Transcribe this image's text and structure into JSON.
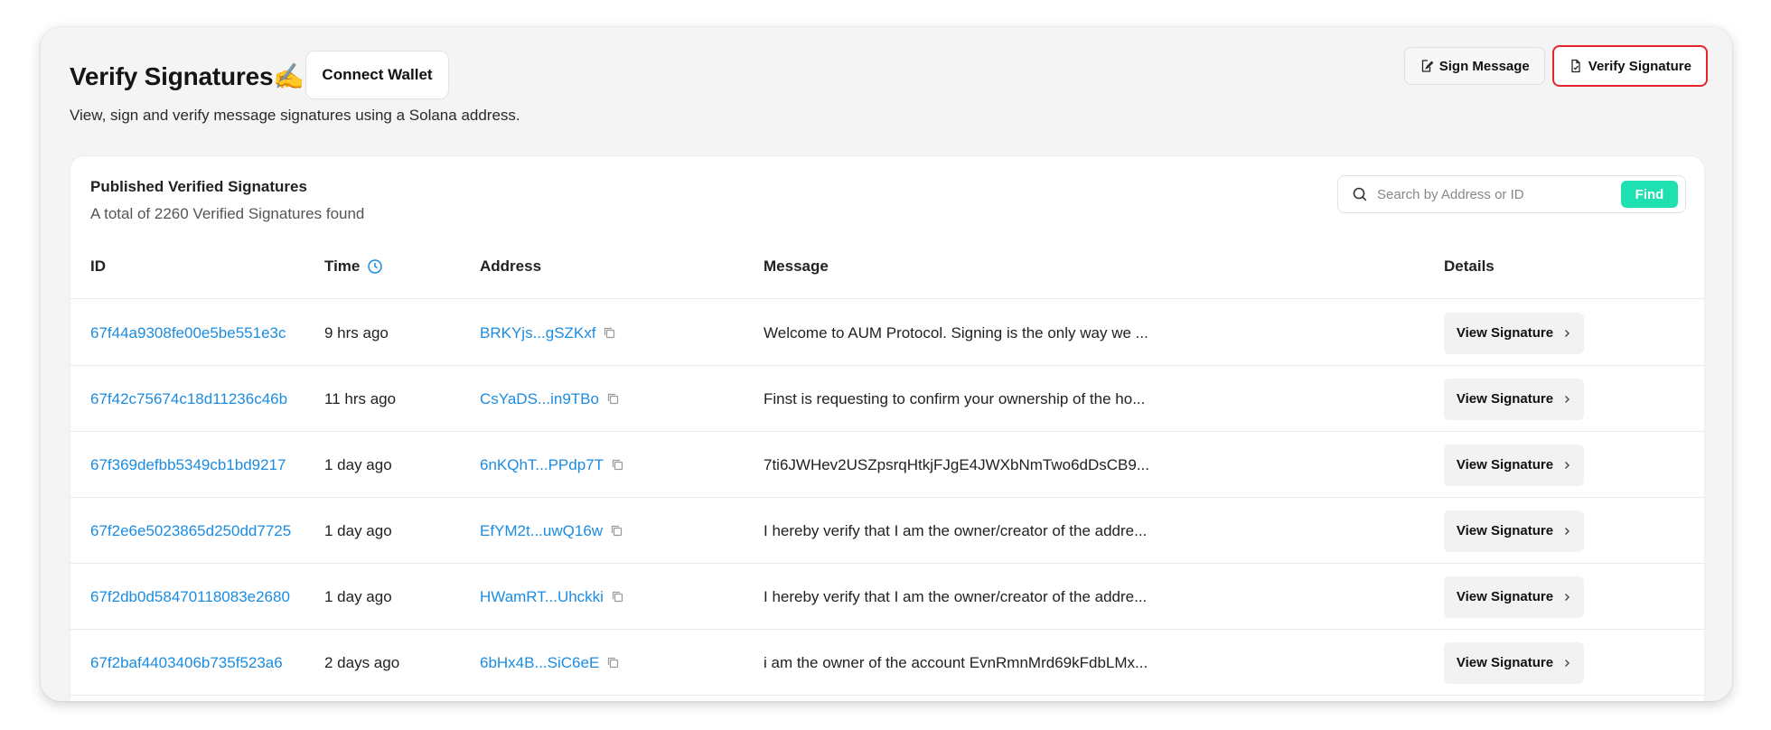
{
  "header": {
    "title": "Verify Signatures✍️",
    "connect_wallet": "Connect Wallet",
    "subtitle": "View, sign and verify message signatures using a Solana address."
  },
  "actions": {
    "sign_message": "Sign Message",
    "verify_signature": "Verify Signature"
  },
  "card": {
    "title": "Published Verified Signatures",
    "count_text": "A total of 2260 Verified Signatures found",
    "search_placeholder": "Search by Address or ID",
    "find_label": "Find"
  },
  "table": {
    "headers": {
      "id": "ID",
      "time": "Time",
      "address": "Address",
      "message": "Message",
      "details": "Details"
    },
    "view_label": "View Signature",
    "rows": [
      {
        "id": "67f44a9308fe00e5be551e3c",
        "time": "9 hrs ago",
        "address": "BRKYjs...gSZKxf",
        "message": "Welcome to AUM Protocol. Signing is the only way we ..."
      },
      {
        "id": "67f42c75674c18d11236c46b",
        "time": "11 hrs ago",
        "address": "CsYaDS...in9TBo",
        "message": "Finst is requesting to confirm your ownership of the ho..."
      },
      {
        "id": "67f369defbb5349cb1bd9217",
        "time": "1 day ago",
        "address": "6nKQhT...PPdp7T",
        "message": "7ti6JWHev2USZpsrqHtkjFJgE4JWXbNmTwo6dDsCB9..."
      },
      {
        "id": "67f2e6e5023865d250dd7725",
        "time": "1 day ago",
        "address": "EfYM2t...uwQ16w",
        "message": "I hereby verify that I am the owner/creator of the addre..."
      },
      {
        "id": "67f2db0d58470118083e2680",
        "time": "1 day ago",
        "address": "HWamRT...Uhckki",
        "message": "I hereby verify that I am the owner/creator of the addre..."
      },
      {
        "id": "67f2baf4403406b735f523a6",
        "time": "2 days ago",
        "address": "6bHx4B...SiC6eE",
        "message": "i am the owner of the account EvnRmnMrd69kFdbLMx..."
      }
    ]
  },
  "colors": {
    "accent_link": "#1c8ce0",
    "find_button": "#1fe0b0",
    "active_border": "#e3262b"
  }
}
